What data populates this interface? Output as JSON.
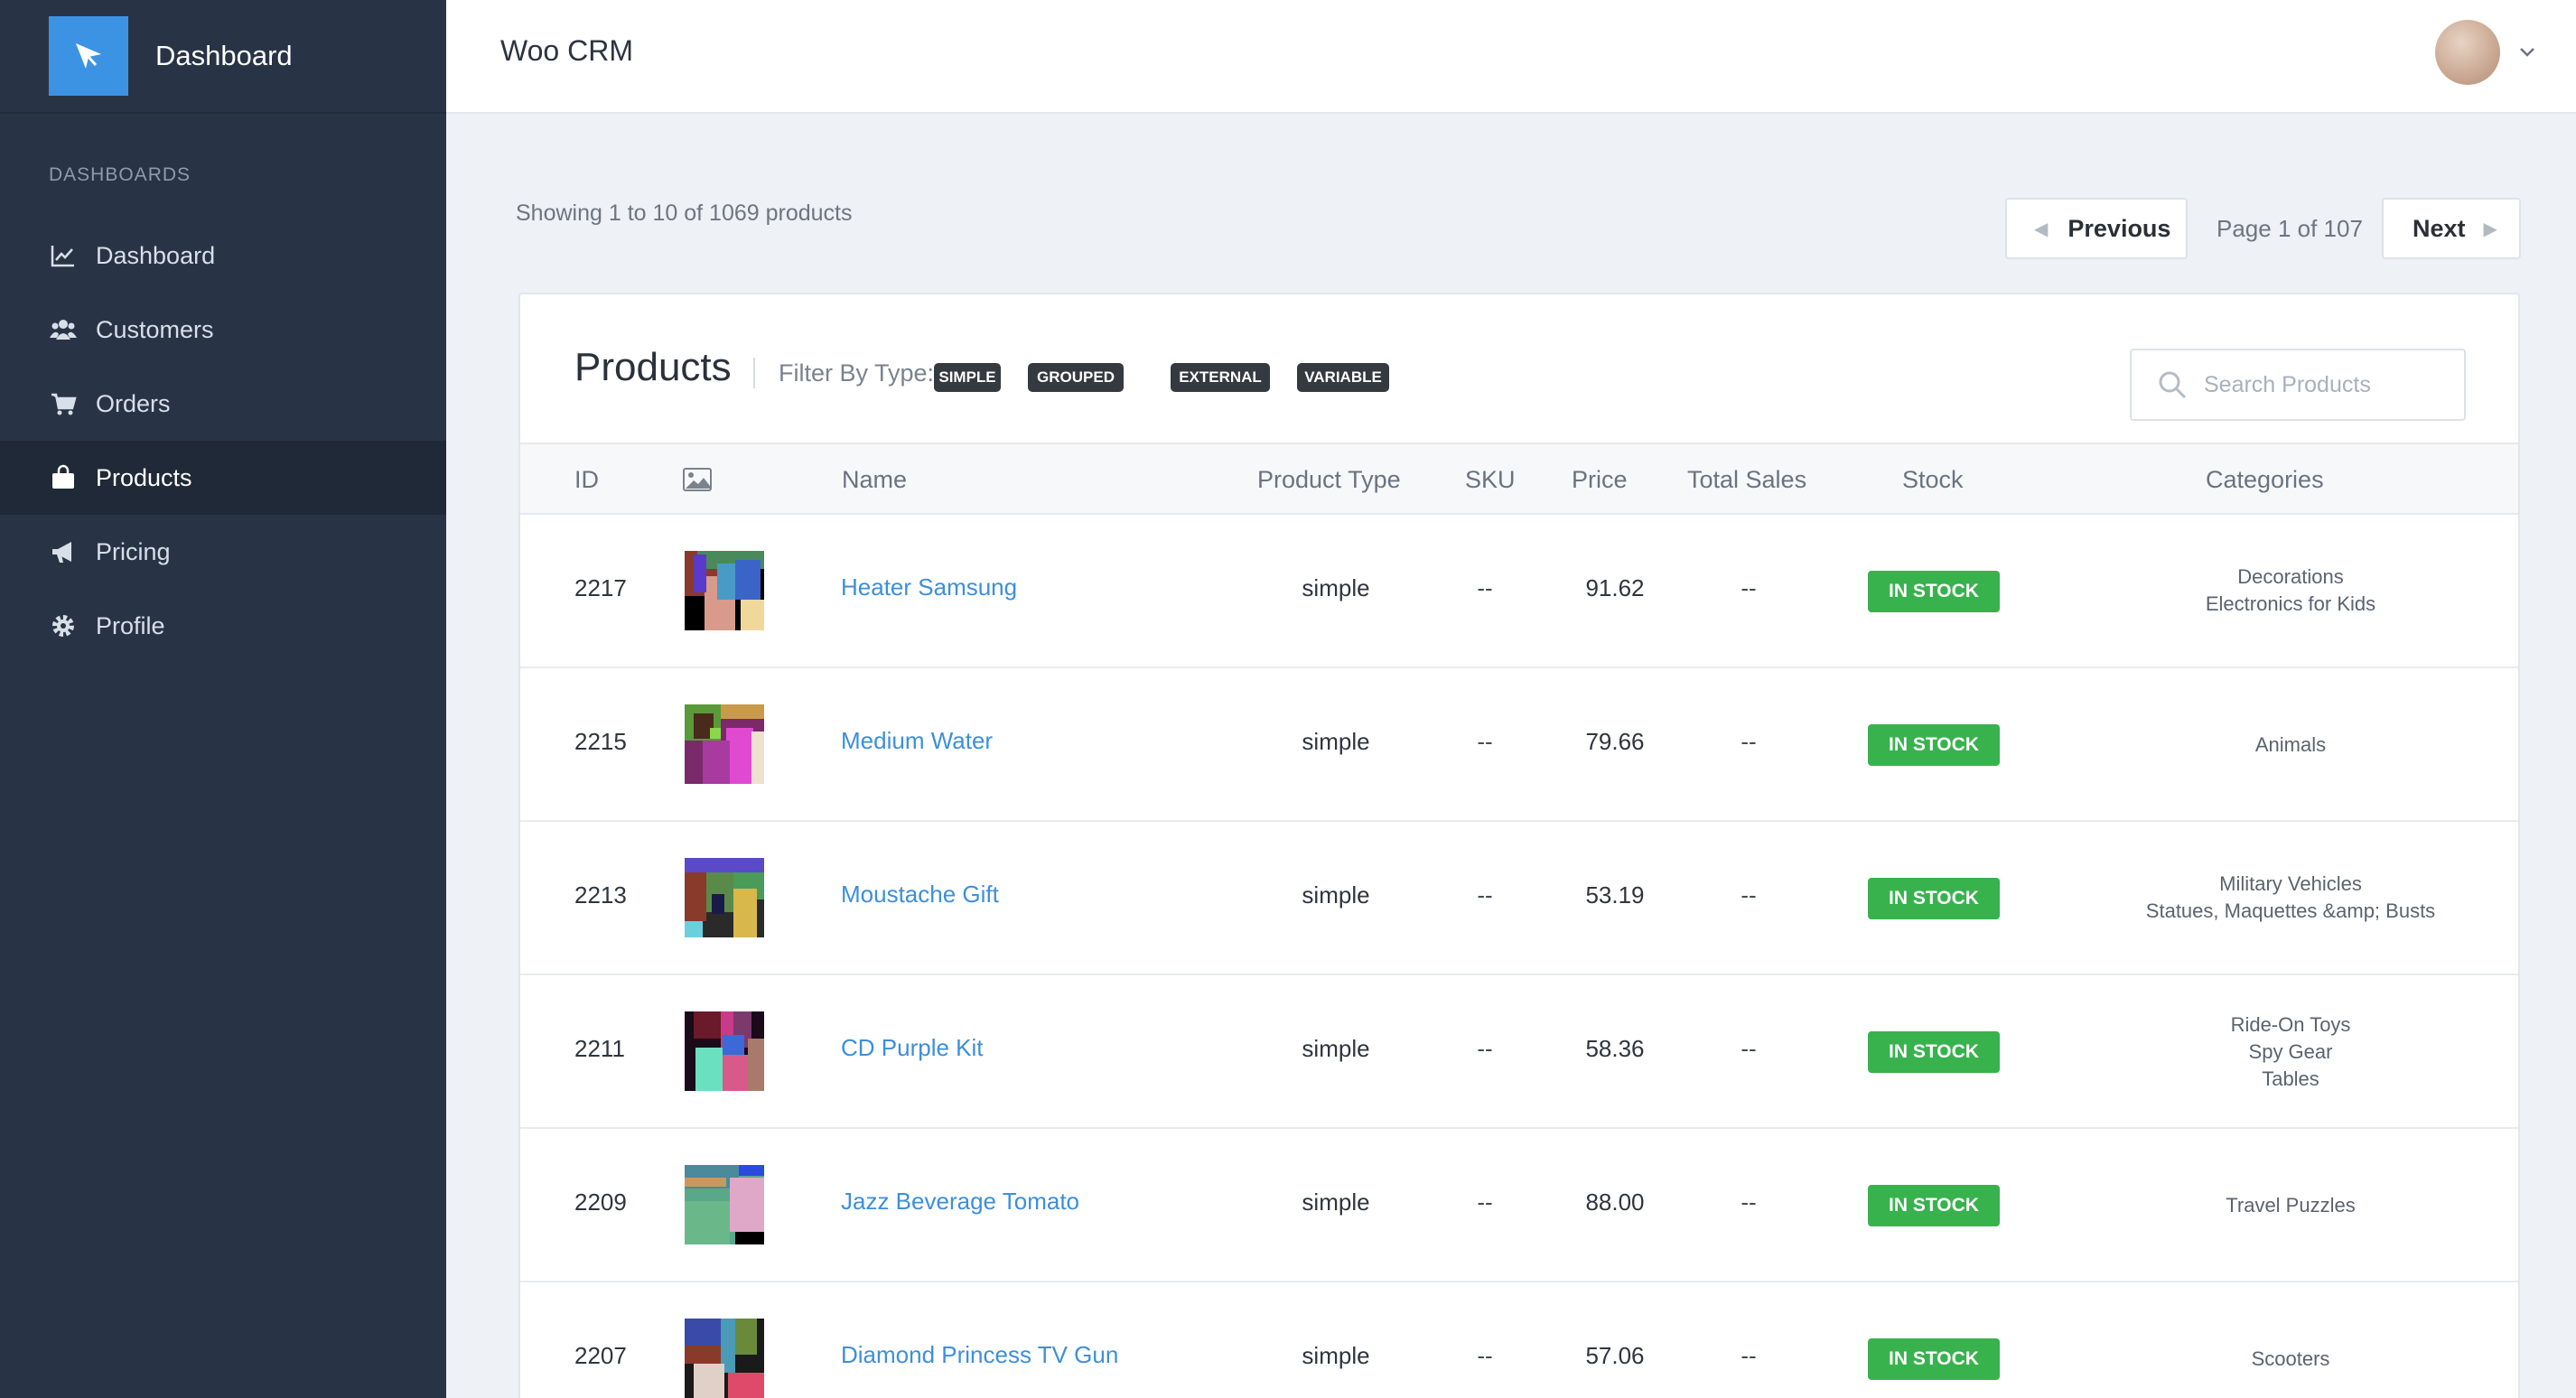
{
  "sidebar": {
    "brand_title": "Dashboard",
    "section_heading": "DASHBOARDS",
    "items": [
      {
        "label": "Dashboard",
        "icon": "chart-line-icon"
      },
      {
        "label": "Customers",
        "icon": "users-icon"
      },
      {
        "label": "Orders",
        "icon": "cart-icon"
      },
      {
        "label": "Products",
        "icon": "shopping-bag-icon",
        "active": true
      },
      {
        "label": "Pricing",
        "icon": "megaphone-icon"
      },
      {
        "label": "Profile",
        "icon": "gear-icon"
      }
    ]
  },
  "header": {
    "app_title": "Woo CRM"
  },
  "listing": {
    "summary": "Showing 1 to 10 of 1069 products",
    "prev_label": "Previous",
    "next_label": "Next",
    "page_info": "Page 1 of 107"
  },
  "products": {
    "title": "Products",
    "filter_label": "Filter By Type:",
    "filters": [
      "SIMPLE",
      "GROUPED",
      "EXTERNAL",
      "VARIABLE"
    ],
    "search_placeholder": "Search Products",
    "columns": {
      "id": "ID",
      "name": "Name",
      "product_type": "Product Type",
      "sku": "SKU",
      "price": "Price",
      "total_sales": "Total Sales",
      "stock": "Stock",
      "categories": "Categories"
    },
    "rows": [
      {
        "id": "2217",
        "name": "Heater Samsung",
        "type": "simple",
        "sku": "--",
        "price": "91.62",
        "sales": "--",
        "stock": "IN STOCK",
        "categories": [
          "Decorations",
          "Electronics for Kids"
        ]
      },
      {
        "id": "2215",
        "name": "Medium Water",
        "type": "simple",
        "sku": "--",
        "price": "79.66",
        "sales": "--",
        "stock": "IN STOCK",
        "categories": [
          "Animals"
        ]
      },
      {
        "id": "2213",
        "name": "Moustache Gift",
        "type": "simple",
        "sku": "--",
        "price": "53.19",
        "sales": "--",
        "stock": "IN STOCK",
        "categories": [
          "Military Vehicles",
          "Statues, Maquettes &amp; Busts"
        ]
      },
      {
        "id": "2211",
        "name": "CD Purple Kit",
        "type": "simple",
        "sku": "--",
        "price": "58.36",
        "sales": "--",
        "stock": "IN STOCK",
        "categories": [
          "Ride-On Toys",
          "Spy Gear",
          "Tables"
        ]
      },
      {
        "id": "2209",
        "name": "Jazz Beverage Tomato",
        "type": "simple",
        "sku": "--",
        "price": "88.00",
        "sales": "--",
        "stock": "IN STOCK",
        "categories": [
          "Travel Puzzles"
        ]
      },
      {
        "id": "2207",
        "name": "Diamond Princess TV Gun",
        "type": "simple",
        "sku": "--",
        "price": "57.06",
        "sales": "--",
        "stock": "IN STOCK",
        "categories": [
          "Scooters"
        ]
      }
    ]
  },
  "colors": {
    "sidebar_bg": "#283446",
    "accent": "#3d93e3",
    "link": "#3d8fd9",
    "in_stock": "#37b24d"
  }
}
